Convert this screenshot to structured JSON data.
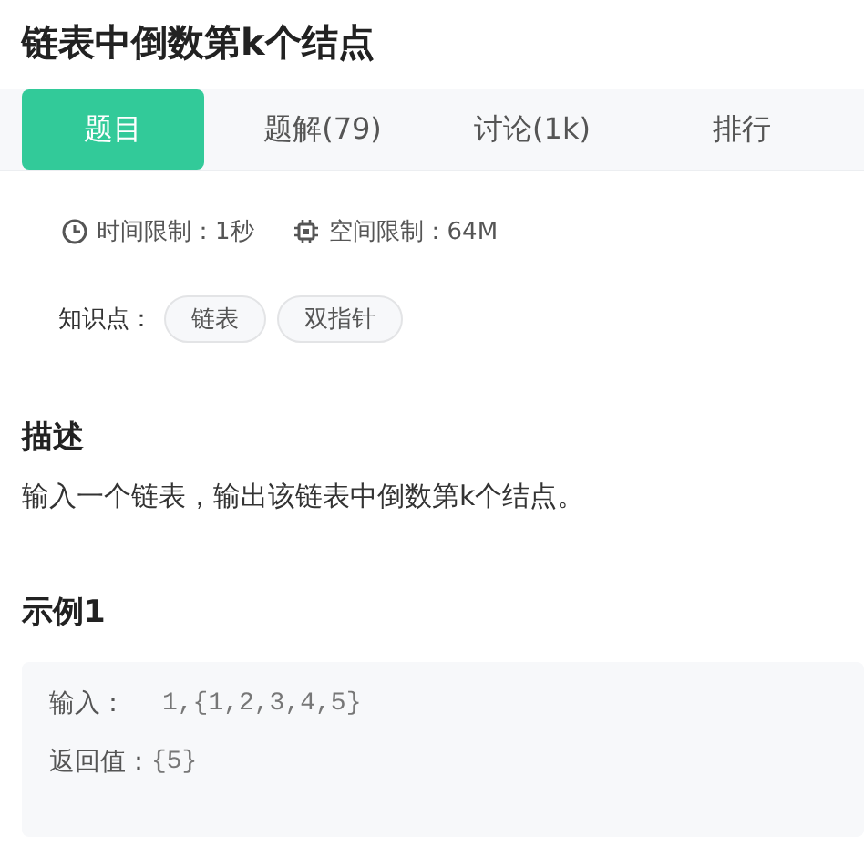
{
  "title": "链表中倒数第k个结点",
  "tabs": [
    {
      "label": "题目",
      "selected": true
    },
    {
      "label": "题解(79)",
      "selected": false
    },
    {
      "label": "讨论(1k)",
      "selected": false
    },
    {
      "label": "排行",
      "selected": false
    }
  ],
  "limits": [
    {
      "kind": "time",
      "text": "时间限制：1秒"
    },
    {
      "kind": "memory",
      "text": "空间限制：64M"
    }
  ],
  "knowledge": {
    "label": "知识点：",
    "tags": [
      "链表",
      "双指针"
    ]
  },
  "description": {
    "heading": "描述",
    "text": "输入一个链表，输出该链表中倒数第k个结点。"
  },
  "examples": [
    {
      "heading": "示例1",
      "rows": [
        {
          "label": "输入：",
          "value": "1,{1,2,3,4,5}"
        },
        {
          "label": "返回值：",
          "value": "{5}"
        }
      ]
    }
  ]
}
